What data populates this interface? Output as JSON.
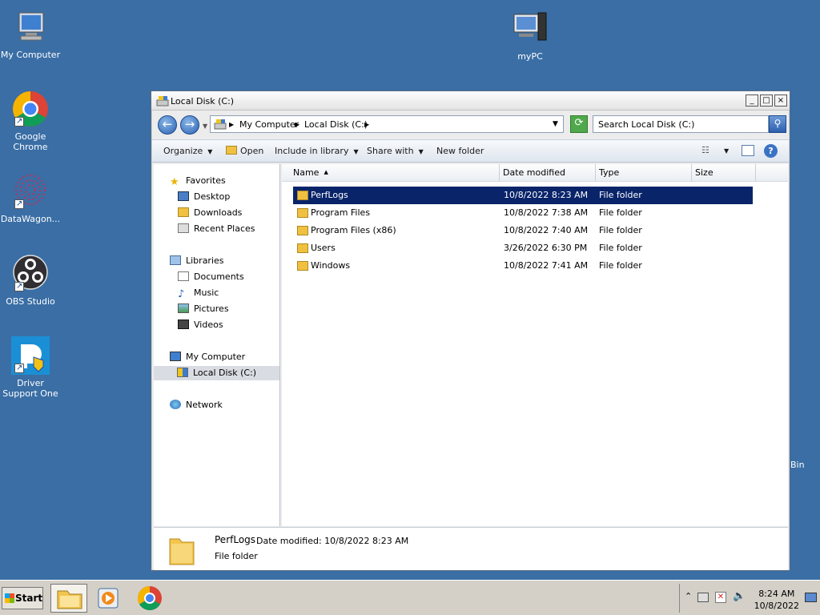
{
  "desktop": {
    "icons": [
      {
        "label": "My Computer"
      },
      {
        "label": "Google Chrome"
      },
      {
        "label": "DataWagon..."
      },
      {
        "label": "OBS Studio"
      },
      {
        "label": "Driver Support One"
      },
      {
        "label": "myPC"
      }
    ],
    "recycle_bin_label": "Bin"
  },
  "window": {
    "title": "Local Disk (C:)",
    "buttons": {
      "minimize": "_",
      "maximize": "□",
      "close": "×"
    },
    "address": {
      "crumbs": [
        "My Computer",
        "Local Disk (C:)"
      ],
      "search_placeholder": "Search Local Disk (C:)"
    },
    "toolbar": {
      "organize": "Organize",
      "open": "Open",
      "include_in_library": "Include in library",
      "share_with": "Share with",
      "new_folder": "New folder"
    },
    "nav": {
      "favorites": "Favorites",
      "desktop": "Desktop",
      "downloads": "Downloads",
      "recent_places": "Recent Places",
      "libraries": "Libraries",
      "documents": "Documents",
      "music": "Music",
      "pictures": "Pictures",
      "videos": "Videos",
      "my_computer": "My Computer",
      "local_disk": "Local Disk (C:)",
      "network": "Network"
    },
    "columns": {
      "name": "Name",
      "date": "Date modified",
      "type": "Type",
      "size": "Size"
    },
    "files": [
      {
        "name": "PerfLogs",
        "date": "10/8/2022 8:23 AM",
        "type": "File folder"
      },
      {
        "name": "Program Files",
        "date": "10/8/2022 7:38 AM",
        "type": "File folder"
      },
      {
        "name": "Program Files (x86)",
        "date": "10/8/2022 7:40 AM",
        "type": "File folder"
      },
      {
        "name": "Users",
        "date": "3/26/2022 6:30 PM",
        "type": "File folder"
      },
      {
        "name": "Windows",
        "date": "10/8/2022 7:41 AM",
        "type": "File folder"
      }
    ],
    "details": {
      "name": "PerfLogs",
      "modified": "Date modified:  10/8/2022 8:23 AM",
      "type": "File folder"
    }
  },
  "taskbar": {
    "start": "Start",
    "time": "8:24 AM",
    "date": "10/8/2022"
  }
}
